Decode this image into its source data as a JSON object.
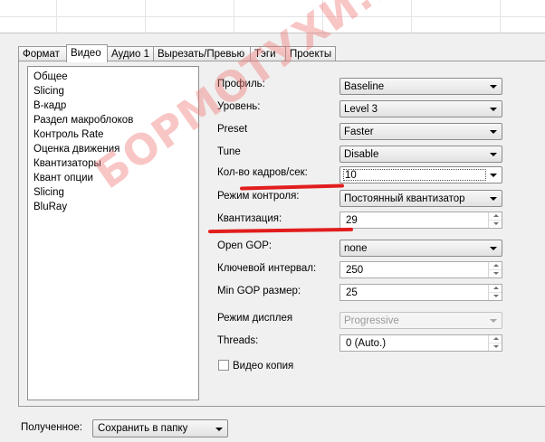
{
  "tabs": [
    "Формат",
    "Видео",
    "Аудио 1",
    "Вырезать/Превью",
    "Тэги",
    "Проекты"
  ],
  "active_tab": "Видео",
  "sidebar": {
    "items": [
      "Общее",
      "Slicing",
      "B-кадр",
      "Раздел макроблоков",
      "Контроль Rate",
      "Оценка движения",
      "Квантизаторы",
      "Квант опции",
      "Slicing",
      "BluRay"
    ],
    "selected": "Общее"
  },
  "settings": {
    "profile": {
      "label": "Профиль:",
      "value": "Baseline"
    },
    "level": {
      "label": "Уровень:",
      "value": "Level 3"
    },
    "preset": {
      "label": "Preset",
      "value": "Faster"
    },
    "tune": {
      "label": "Tune",
      "value": "Disable"
    },
    "fps": {
      "label": "Кол-во кадров/сек:",
      "value": "10"
    },
    "control_mode": {
      "label": "Режим контроля:",
      "value": "Постоянный квантизатор"
    },
    "quantization": {
      "label": "Квантизация:",
      "value": "29"
    },
    "open_gop": {
      "label": "Open GOP:",
      "value": "none"
    },
    "keyframe_interval": {
      "label": "Ключевой интервал:",
      "value": "250"
    },
    "min_gop": {
      "label": "Min GOP размер:",
      "value": "25"
    },
    "display_mode": {
      "label": "Режим дисплея",
      "value": "Progressive"
    },
    "threads": {
      "label": "Threads:",
      "value": "0 (Auto.)"
    },
    "video_copy": {
      "label": "Видео копия",
      "checked": false
    }
  },
  "bottom": {
    "label": "Полученное:",
    "value": "Сохранить в папку"
  },
  "watermark": "БОРМОТУХИ.НЕТ",
  "colors": {
    "annotation_red": "#e21d1d",
    "watermark": "#f07878"
  }
}
